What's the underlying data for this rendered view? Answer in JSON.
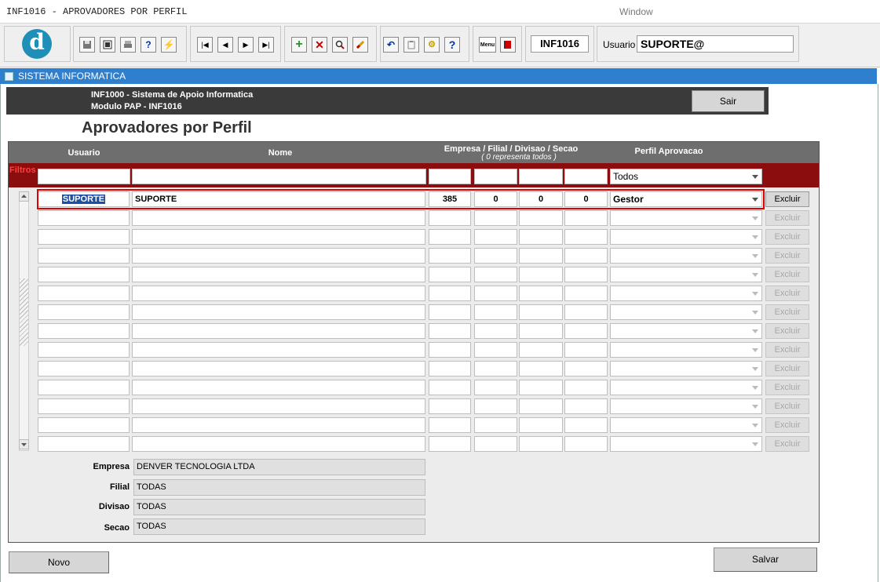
{
  "window": {
    "title": "INF1016 - APROVADORES POR PERFIL",
    "menu": "Window"
  },
  "toolbar": {
    "form_code": "INF1016",
    "usuario_label": "Usuario",
    "usuario_value": "SUPORTE@",
    "logo_letter": "d",
    "menu_icon_text": "Menu"
  },
  "inner_window": {
    "title": "SISTEMA INFORMATICA"
  },
  "system": {
    "line1": "INF1000 - Sistema de Apoio Informatica",
    "line2": "Modulo PAP - INF1016",
    "sair_label": "Sair"
  },
  "page": {
    "title": "Aprovadores por Perfil"
  },
  "grid": {
    "headers": {
      "usuario": "Usuario",
      "nome": "Nome",
      "org": "Empresa / Filial / Divisao / Secao",
      "org_note": "( 0 representa todos )",
      "perfil": "Perfil Aprovacao"
    },
    "filtros_label": "Filtros",
    "filter": {
      "usuario": "",
      "nome": "",
      "empresa": "",
      "filial": "",
      "divisao": "",
      "secao": "",
      "perfil": "Todos"
    },
    "rows": [
      {
        "usuario": "SUPORTE",
        "nome": "SUPORTE",
        "empresa": "385",
        "filial": "0",
        "divisao": "0",
        "secao": "0",
        "perfil": "Gestor",
        "excluir": "Excluir"
      }
    ],
    "empty_excluir": "Excluir"
  },
  "details": {
    "empresa_label": "Empresa",
    "empresa_value": "DENVER TECNOLOGIA LTDA",
    "filial_label": "Filial",
    "filial_value": "TODAS",
    "divisao_label": "Divisao",
    "divisao_value": "TODAS",
    "secao_label": "Secao",
    "secao_value": "TODAS"
  },
  "buttons": {
    "novo": "Novo",
    "salvar": "Salvar"
  },
  "colors": {
    "header_blue": "#2f7fcf",
    "filter_band": "#8b0d0d",
    "grid_header": "#6e6e6e",
    "highlight": "#e00000"
  }
}
